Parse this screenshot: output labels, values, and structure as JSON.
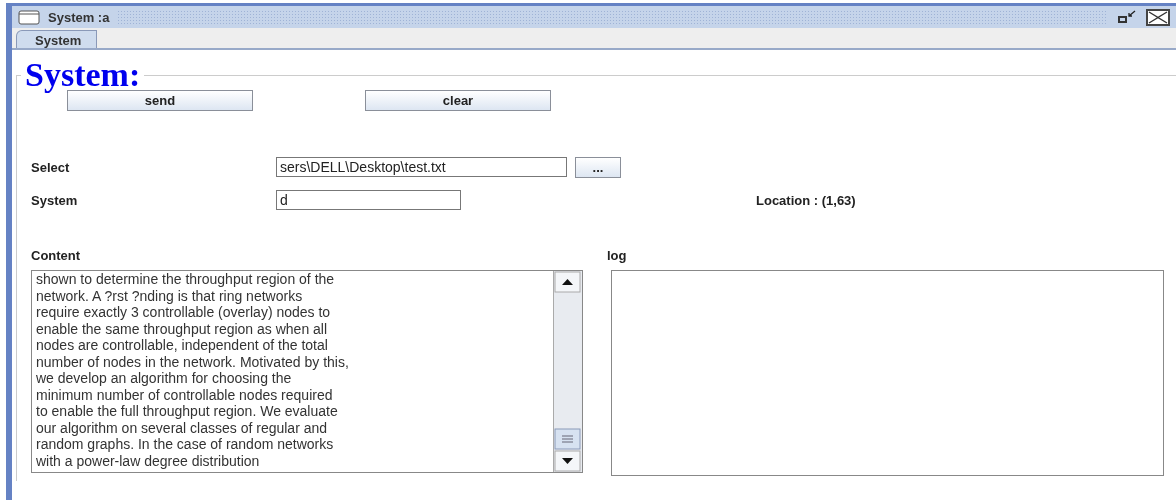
{
  "window": {
    "title": "System :a"
  },
  "tabs": [
    {
      "label": "System",
      "selected": true
    }
  ],
  "panel": {
    "legend": "System:",
    "buttons": [
      {
        "label": "send"
      },
      {
        "label": "clear"
      }
    ],
    "select": {
      "label": "Select",
      "value": "sers\\DELL\\Desktop\\test.txt",
      "browse": "..."
    },
    "system": {
      "label": "System",
      "value": "d"
    },
    "location": "Location : (1,63)",
    "content": {
      "label": "Content",
      "value": "shown to determine the throughput region of the\nnetwork. A ?rst ?nding is that ring networks\nrequire exactly 3 controllable (overlay) nodes to\nenable the same throughput region as when all\nnodes are controllable, independent of the total\nnumber of nodes in the network. Motivated by this,\nwe develop an algorithm for choosing the\nminimum number of controllable nodes required\nto enable the full throughput region. We evaluate\nour algorithm on several classes of regular and\nrandom graphs. In the case of random networks\nwith a power-law degree distribution"
    },
    "log": {
      "label": "log"
    }
  }
}
